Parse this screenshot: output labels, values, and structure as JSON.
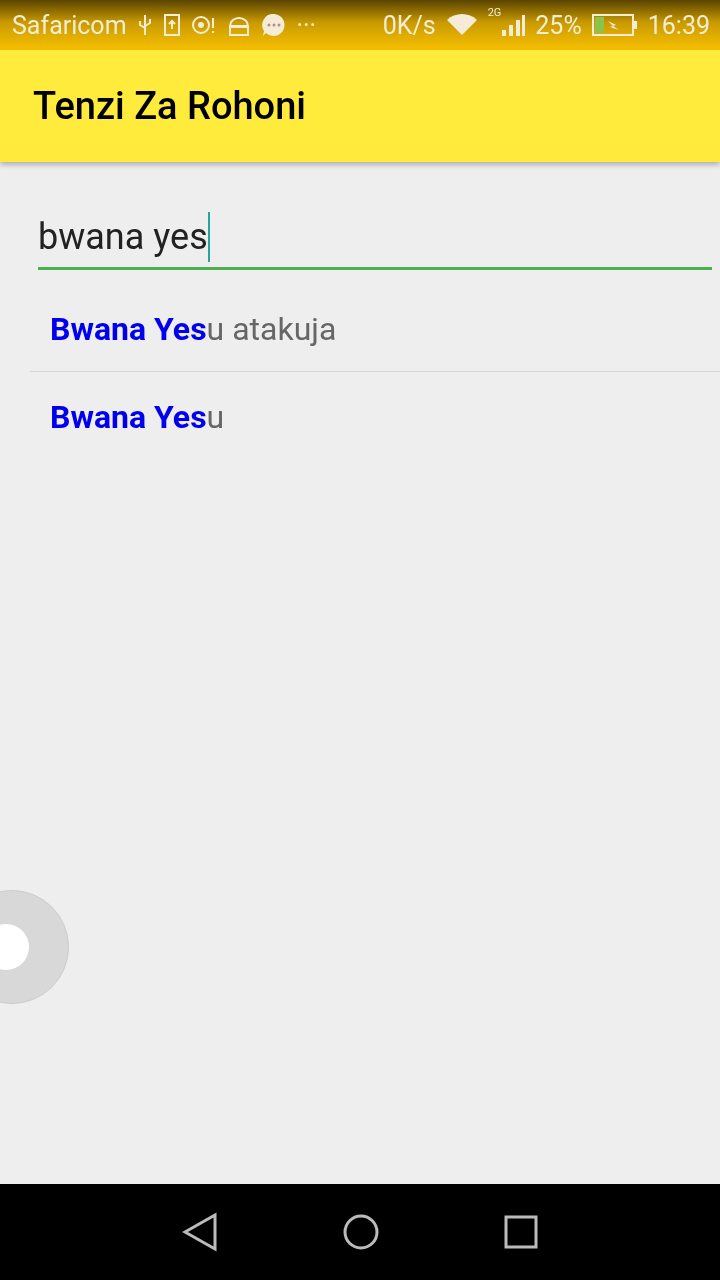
{
  "status_bar": {
    "carrier": "Safaricom",
    "more": "···",
    "speed": "0K/s",
    "network": "2G",
    "battery": "25%",
    "time": "16:39"
  },
  "app_bar": {
    "title": "Tenzi Za Rohoni"
  },
  "search": {
    "value": "bwana yes"
  },
  "suggestions": [
    {
      "match": "Bwana Yes",
      "rest": "u atakuja"
    },
    {
      "match": "Bwana Yes",
      "rest": "u"
    }
  ]
}
